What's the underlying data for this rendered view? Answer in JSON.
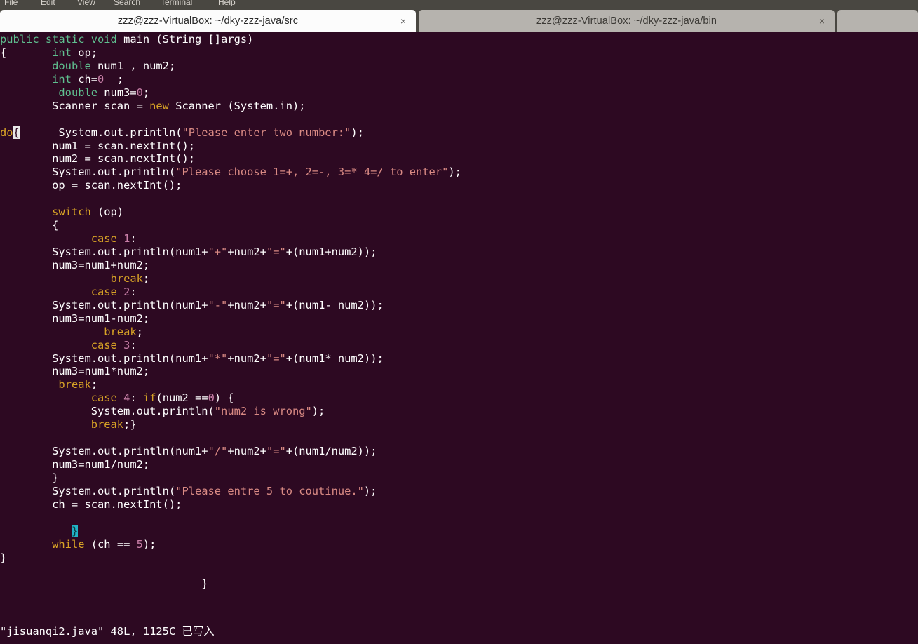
{
  "window": {
    "menubar": [
      "File",
      "Edit",
      "View",
      "Search",
      "Terminal",
      "Help"
    ],
    "tabs": [
      {
        "title": "zzz@zzz-VirtualBox: ~/dky-zzz-java/src",
        "close_label": "×",
        "state": "active"
      },
      {
        "title": "zzz@zzz-VirtualBox: ~/dky-zzz-java/bin",
        "close_label": "×",
        "state": "inactive"
      }
    ],
    "colors": {
      "terminal_background": "#2d0922",
      "chrome_background": "#494741",
      "active_tab_background": "#fcfcfc",
      "inactive_tab_background": "#b6b3ae",
      "keyword": "#d8a326",
      "type": "#5fbf8f",
      "string": "#d98a84",
      "number": "#c97fa8",
      "cursor_highlight": "#e8e8e8",
      "match_brace_highlight": "#21b2c4"
    }
  },
  "editor": {
    "status_line": {
      "filename": "\"jisuanqi2.java\"",
      "lines": "48L,",
      "chars": "1125C",
      "message": "已写入"
    },
    "lines": [
      [
        {
          "t": "typ",
          "s": "public static void"
        },
        {
          "t": "pln",
          "s": " main (String []args)"
        }
      ],
      [
        {
          "t": "pln",
          "s": "{       "
        },
        {
          "t": "typ",
          "s": "int"
        },
        {
          "t": "pln",
          "s": " op;"
        }
      ],
      [
        {
          "t": "pln",
          "s": "        "
        },
        {
          "t": "typ",
          "s": "double"
        },
        {
          "t": "pln",
          "s": " num1 , num2;"
        }
      ],
      [
        {
          "t": "pln",
          "s": "        "
        },
        {
          "t": "typ",
          "s": "int"
        },
        {
          "t": "pln",
          "s": " ch="
        },
        {
          "t": "num",
          "s": "0"
        },
        {
          "t": "pln",
          "s": "  ;"
        }
      ],
      [
        {
          "t": "pln",
          "s": "         "
        },
        {
          "t": "typ",
          "s": "double"
        },
        {
          "t": "pln",
          "s": " num3="
        },
        {
          "t": "num",
          "s": "0"
        },
        {
          "t": "pln",
          "s": ";"
        }
      ],
      [
        {
          "t": "pln",
          "s": "        Scanner scan = "
        },
        {
          "t": "kw",
          "s": "new"
        },
        {
          "t": "pln",
          "s": " Scanner (System.in);"
        }
      ],
      [],
      [
        {
          "t": "kw",
          "s": "do"
        },
        {
          "t": "cursor",
          "s": "{"
        },
        {
          "t": "pln",
          "s": "      System.out.println("
        },
        {
          "t": "str",
          "s": "\"Please enter two number:\""
        },
        {
          "t": "pln",
          "s": ");"
        }
      ],
      [
        {
          "t": "pln",
          "s": "        num1 = scan.nextInt();"
        }
      ],
      [
        {
          "t": "pln",
          "s": "        num2 = scan.nextInt();"
        }
      ],
      [
        {
          "t": "pln",
          "s": "        System.out.println("
        },
        {
          "t": "str",
          "s": "\"Please choose 1=+, 2=-, 3=* 4=/ to enter\""
        },
        {
          "t": "pln",
          "s": ");"
        }
      ],
      [
        {
          "t": "pln",
          "s": "        op = scan.nextInt();"
        }
      ],
      [],
      [
        {
          "t": "pln",
          "s": "        "
        },
        {
          "t": "kw",
          "s": "switch"
        },
        {
          "t": "pln",
          "s": " (op)"
        }
      ],
      [
        {
          "t": "pln",
          "s": "        {"
        }
      ],
      [
        {
          "t": "pln",
          "s": "              "
        },
        {
          "t": "kw",
          "s": "case"
        },
        {
          "t": "pln",
          "s": " "
        },
        {
          "t": "num",
          "s": "1"
        },
        {
          "t": "pln",
          "s": ":"
        }
      ],
      [
        {
          "t": "pln",
          "s": "        System.out.println(num1+"
        },
        {
          "t": "str",
          "s": "\"+\""
        },
        {
          "t": "pln",
          "s": "+num2+"
        },
        {
          "t": "str",
          "s": "\"=\""
        },
        {
          "t": "pln",
          "s": "+(num1+num2));"
        }
      ],
      [
        {
          "t": "pln",
          "s": "        num3=num1+num2;"
        }
      ],
      [
        {
          "t": "pln",
          "s": "                 "
        },
        {
          "t": "kw",
          "s": "break"
        },
        {
          "t": "pln",
          "s": ";"
        }
      ],
      [
        {
          "t": "pln",
          "s": "              "
        },
        {
          "t": "kw",
          "s": "case"
        },
        {
          "t": "pln",
          "s": " "
        },
        {
          "t": "num",
          "s": "2"
        },
        {
          "t": "pln",
          "s": ":"
        }
      ],
      [
        {
          "t": "pln",
          "s": "        System.out.println(num1+"
        },
        {
          "t": "str",
          "s": "\"-\""
        },
        {
          "t": "pln",
          "s": "+num2+"
        },
        {
          "t": "str",
          "s": "\"=\""
        },
        {
          "t": "pln",
          "s": "+(num1- num2));"
        }
      ],
      [
        {
          "t": "pln",
          "s": "        num3=num1-num2;"
        }
      ],
      [
        {
          "t": "pln",
          "s": "                "
        },
        {
          "t": "kw",
          "s": "break"
        },
        {
          "t": "pln",
          "s": ";"
        }
      ],
      [
        {
          "t": "pln",
          "s": "              "
        },
        {
          "t": "kw",
          "s": "case"
        },
        {
          "t": "pln",
          "s": " "
        },
        {
          "t": "num",
          "s": "3"
        },
        {
          "t": "pln",
          "s": ":"
        }
      ],
      [
        {
          "t": "pln",
          "s": "        System.out.println(num1+"
        },
        {
          "t": "str",
          "s": "\"*\""
        },
        {
          "t": "pln",
          "s": "+num2+"
        },
        {
          "t": "str",
          "s": "\"=\""
        },
        {
          "t": "pln",
          "s": "+(num1* num2));"
        }
      ],
      [
        {
          "t": "pln",
          "s": "        num3=num1*num2;"
        }
      ],
      [
        {
          "t": "pln",
          "s": "         "
        },
        {
          "t": "kw",
          "s": "break"
        },
        {
          "t": "pln",
          "s": ";"
        }
      ],
      [
        {
          "t": "pln",
          "s": "              "
        },
        {
          "t": "kw",
          "s": "case"
        },
        {
          "t": "pln",
          "s": " "
        },
        {
          "t": "num",
          "s": "4"
        },
        {
          "t": "pln",
          "s": ": "
        },
        {
          "t": "kw",
          "s": "if"
        },
        {
          "t": "pln",
          "s": "(num2 =="
        },
        {
          "t": "num",
          "s": "0"
        },
        {
          "t": "pln",
          "s": ") {"
        }
      ],
      [
        {
          "t": "pln",
          "s": "              System.out.println("
        },
        {
          "t": "str",
          "s": "\"num2 is wrong\""
        },
        {
          "t": "pln",
          "s": ");"
        }
      ],
      [
        {
          "t": "pln",
          "s": "              "
        },
        {
          "t": "kw",
          "s": "break"
        },
        {
          "t": "pln",
          "s": ";}"
        }
      ],
      [],
      [
        {
          "t": "pln",
          "s": "        System.out.println(num1+"
        },
        {
          "t": "str",
          "s": "\"/\""
        },
        {
          "t": "pln",
          "s": "+num2+"
        },
        {
          "t": "str",
          "s": "\"=\""
        },
        {
          "t": "pln",
          "s": "+(num1/num2));"
        }
      ],
      [
        {
          "t": "pln",
          "s": "        num3=num1/num2;"
        }
      ],
      [
        {
          "t": "pln",
          "s": "        }"
        }
      ],
      [
        {
          "t": "pln",
          "s": "        System.out.println("
        },
        {
          "t": "str",
          "s": "\"Please entre 5 to coutinue.\""
        },
        {
          "t": "pln",
          "s": ");"
        }
      ],
      [
        {
          "t": "pln",
          "s": "        ch = scan.nextInt();"
        }
      ],
      [],
      [
        {
          "t": "pln",
          "s": "           "
        },
        {
          "t": "matchbrace",
          "s": "}"
        }
      ],
      [
        {
          "t": "pln",
          "s": "        "
        },
        {
          "t": "kw",
          "s": "while"
        },
        {
          "t": "pln",
          "s": " (ch == "
        },
        {
          "t": "num",
          "s": "5"
        },
        {
          "t": "pln",
          "s": ");"
        }
      ],
      [
        {
          "t": "pln",
          "s": "}"
        }
      ],
      [],
      [
        {
          "t": "pln",
          "s": "                               }"
        }
      ]
    ]
  }
}
